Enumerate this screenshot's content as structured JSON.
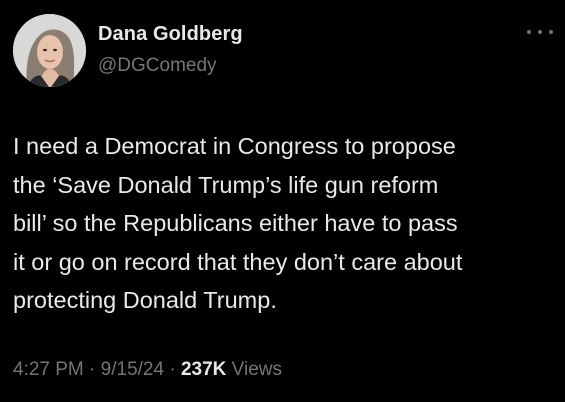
{
  "author": {
    "display_name": "Dana Goldberg",
    "handle": "@DGComedy",
    "avatar_icon": "profile-photo"
  },
  "more_icon": "more-horizontal-icon",
  "tweet": {
    "lines": [
      "I need a Democrat in Congress to propose",
      "the ‘Save Donald Trump’s life gun reform",
      "bill’ so the Republicans either have to pass",
      "it or go on record that they don’t care about",
      "protecting Donald Trump."
    ]
  },
  "meta": {
    "time": "4:27 PM",
    "separator": "·",
    "date": "9/15/24",
    "views_count": "237K",
    "views_label": "Views"
  },
  "colors": {
    "background": "#000000",
    "primary_text": "#e7e9ea",
    "secondary_text": "#71767b"
  }
}
